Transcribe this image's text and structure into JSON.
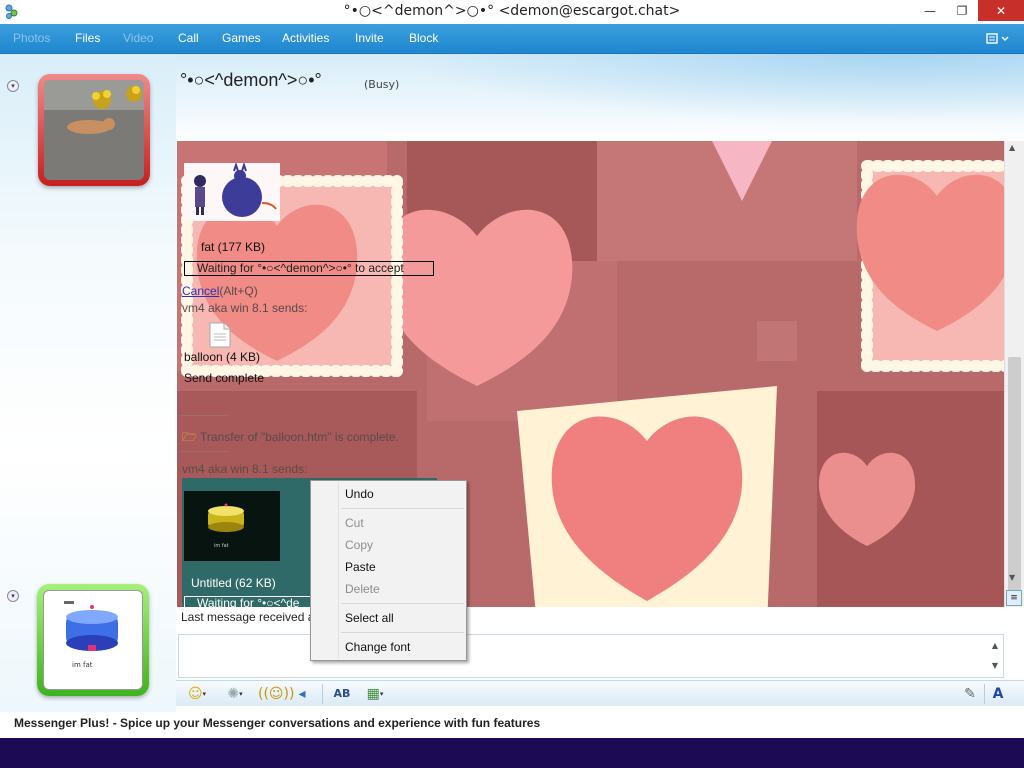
{
  "window": {
    "title": "°•○<^demon^>○•° <demon@escargot.chat>",
    "minimize_glyph": "—",
    "maximize_glyph": "❐",
    "close_glyph": "✕"
  },
  "menu": {
    "items": [
      {
        "label": "Photos",
        "enabled": false
      },
      {
        "label": "Files",
        "enabled": true
      },
      {
        "label": "Video",
        "enabled": false
      },
      {
        "label": "Call",
        "enabled": true
      },
      {
        "label": "Games",
        "enabled": true
      },
      {
        "label": "Activities",
        "enabled": true
      },
      {
        "label": "Invite",
        "enabled": true
      },
      {
        "label": "Block",
        "enabled": true
      }
    ],
    "options_icon": "options-menu-icon"
  },
  "contact": {
    "name": "°•○<^demon^>○•°",
    "status": "(Busy)"
  },
  "self_avatar": {
    "caption": "im fat"
  },
  "chat": {
    "file1": {
      "name": "fat (177 KB)",
      "waiting": "Waiting for °•○<^demon^>○•° to accept",
      "cancel_label": "Cancel",
      "cancel_shortcut": "(Alt+Q)"
    },
    "sender1": "vm4 aka win 8.1 sends:",
    "file2": {
      "name": "balloon (4 KB)",
      "status": "Send complete"
    },
    "transfer_complete": "Transfer of \"balloon.htm\" is complete.",
    "sender2": "vm4 aka win 8.1 sends:",
    "file3": {
      "name": "Untitled (62 KB)",
      "waiting_partial": "Waiting for °•○<^de",
      "thumbnail_caption": "im fat"
    }
  },
  "status_line": "Last message received at",
  "context_menu": {
    "items": [
      {
        "label": "Undo",
        "enabled": true
      },
      {
        "label": "Cut",
        "enabled": false
      },
      {
        "label": "Copy",
        "enabled": false
      },
      {
        "label": "Paste",
        "enabled": true
      },
      {
        "label": "Delete",
        "enabled": false
      },
      {
        "label": "Select all",
        "enabled": true
      },
      {
        "label": "Change font",
        "enabled": true
      }
    ]
  },
  "toolbar": {
    "emoticon_icon": "emoticon-icon",
    "wink_icon": "wink-icon",
    "nudge_icon": "nudge-icon",
    "voice_clip_icon": "voice-clip-icon",
    "font_icon": "font-icon",
    "background_icon": "background-icon",
    "handwriting_icon": "handwriting-icon",
    "text_format_icon": "text-format-icon"
  },
  "footer": {
    "plus_text": "Messenger Plus! - Spice up your Messenger conversations and experience with fun features"
  },
  "colors": {
    "menubar": "#2a93d8",
    "close_button": "#c7302a",
    "chat_background": "#b56565",
    "taskbar": "#1d0a54"
  }
}
